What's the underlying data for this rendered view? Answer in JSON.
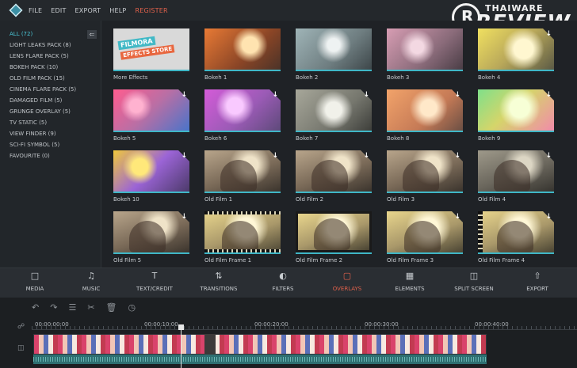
{
  "menu": {
    "file": "FILE",
    "edit": "EDIT",
    "export": "EXPORT",
    "help": "HELP",
    "register": "REGISTER"
  },
  "watermark": {
    "circle": "R",
    "top": "THAIWARE",
    "main": "REVIEW"
  },
  "left_panel": {
    "collapse": "⇐",
    "categories": [
      "ALL (72)",
      "LIGHT LEAKS PACK (8)",
      "LENS FLARE PACK (5)",
      "BOKEH PACK (10)",
      "OLD FILM PACK (15)",
      "CINEMA FLARE PACK (5)",
      "DAMAGED FILM (5)",
      "GRUNGE OVERLAY (5)",
      "TV STATIC (5)",
      "VIEW FINDER (9)",
      "SCI-FI SYMBOL (5)",
      "FAVOURITE (0)"
    ]
  },
  "store": {
    "line1": "FILMORA",
    "line2": "EFFECTS STORE"
  },
  "thumbs": [
    "More Effects",
    "Bokeh 1",
    "Bokeh 2",
    "Bokeh 3",
    "Bokeh 4",
    "Bokeh 5",
    "Bokeh 6",
    "Bokeh 7",
    "Bokeh 8",
    "Bokeh 9",
    "Bokeh 10",
    "Old Film 1",
    "Old Film 2",
    "Old Film 3",
    "Old Film 4",
    "Old Film 5",
    "Old Film Frame 1",
    "Old Film Frame 2",
    "Old Film Frame 3",
    "Old Film Frame 4"
  ],
  "download_icon": "↓",
  "toolbar": {
    "media": "MEDIA",
    "music": "MUSIC",
    "text": "TEXT/CREDIT",
    "transitions": "TRANSITIONS",
    "filters": "FILTERS",
    "overlays": "OVERLAYS",
    "elements": "ELEMENTS",
    "split": "SPLIT SCREEN",
    "export": "EXPORT",
    "active_color": "#e0614b"
  },
  "timeline": {
    "ticks": [
      "00:00:00:00",
      "00:00:10:00",
      "00:00:20:00",
      "00:00:30:00",
      "00:00:40:00"
    ]
  },
  "colors": {
    "accent": "#3fb7c7",
    "active": "#e0614b",
    "bg": "#1f2226"
  }
}
